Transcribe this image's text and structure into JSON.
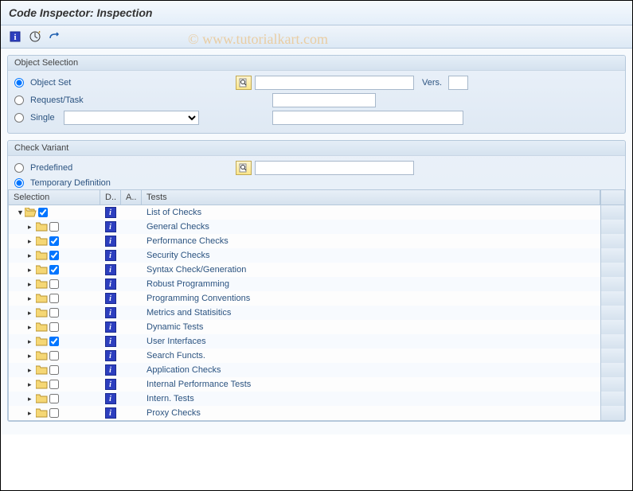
{
  "title": "Code Inspector: Inspection",
  "watermark": "© www.tutorialkart.com",
  "sections": {
    "objectSelection": {
      "title": "Object Selection",
      "options": {
        "objectSet": "Object Set",
        "requestTask": "Request/Task",
        "single": "Single",
        "vers": "Vers."
      }
    },
    "checkVariant": {
      "title": "Check Variant",
      "options": {
        "predefined": "Predefined",
        "temporary": "Temporary Definition"
      }
    }
  },
  "treeHeaders": {
    "selection": "Selection",
    "d": "D..",
    "a": "A..",
    "tests": "Tests"
  },
  "treeRows": [
    {
      "indent": 0,
      "expanded": true,
      "checked": true,
      "label": "List of Checks"
    },
    {
      "indent": 1,
      "expanded": false,
      "checked": false,
      "label": "General Checks"
    },
    {
      "indent": 1,
      "expanded": false,
      "checked": true,
      "label": "Performance Checks"
    },
    {
      "indent": 1,
      "expanded": false,
      "checked": true,
      "label": "Security Checks"
    },
    {
      "indent": 1,
      "expanded": false,
      "checked": true,
      "label": "Syntax Check/Generation"
    },
    {
      "indent": 1,
      "expanded": false,
      "checked": false,
      "label": "Robust Programming"
    },
    {
      "indent": 1,
      "expanded": false,
      "checked": false,
      "label": "Programming Conventions"
    },
    {
      "indent": 1,
      "expanded": false,
      "checked": false,
      "label": "Metrics and Statisitics"
    },
    {
      "indent": 1,
      "expanded": false,
      "checked": false,
      "label": "Dynamic Tests"
    },
    {
      "indent": 1,
      "expanded": false,
      "checked": true,
      "label": "User Interfaces"
    },
    {
      "indent": 1,
      "expanded": false,
      "checked": false,
      "label": "Search Functs."
    },
    {
      "indent": 1,
      "expanded": false,
      "checked": false,
      "label": "Application Checks"
    },
    {
      "indent": 1,
      "expanded": false,
      "checked": false,
      "label": "Internal Performance Tests"
    },
    {
      "indent": 1,
      "expanded": false,
      "checked": false,
      "label": "Intern. Tests"
    },
    {
      "indent": 1,
      "expanded": false,
      "checked": false,
      "label": "Proxy Checks"
    }
  ]
}
